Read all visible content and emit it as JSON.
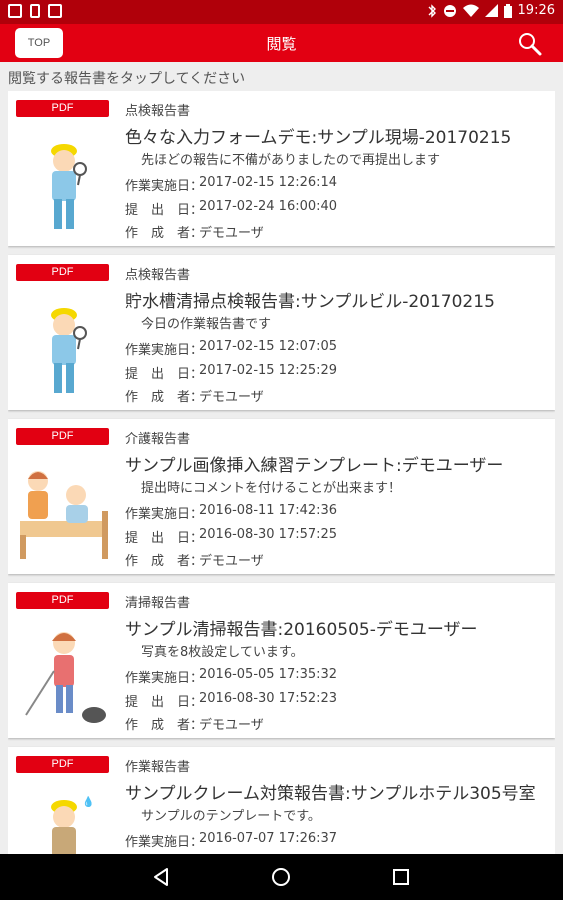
{
  "status_bar": {
    "time": "19:26"
  },
  "app_bar": {
    "top_label": "TOP",
    "title": "閲覧"
  },
  "hint": "閲覧する報告書をタップしてください",
  "labels": {
    "date_label": "作業実施日：",
    "submit_label": "提　出　日：",
    "author_label": "作　成　者："
  },
  "reports": [
    {
      "badge": "PDF",
      "category": "点検報告書",
      "title": "色々な入力フォームデモ:サンプル現場-20170215",
      "comment": "先ほどの報告に不備がありましたので再提出します",
      "work_date": "2017-02-15 12:26:14",
      "submit_date": "2017-02-24 16:00:40",
      "author": "デモユーザ",
      "illustration": "worker-magnifier"
    },
    {
      "badge": "PDF",
      "category": "点検報告書",
      "title": "貯水槽清掃点検報告書:サンプルビル-20170215",
      "comment": "今日の作業報告書です",
      "work_date": "2017-02-15 12:07:05",
      "submit_date": "2017-02-15 12:25:29",
      "author": "デモユーザ",
      "illustration": "worker-magnifier"
    },
    {
      "badge": "PDF",
      "category": "介護報告書",
      "title": "サンプル画像挿入練習テンプレート:デモユーザー",
      "comment": "提出時にコメントを付けることが出来ます！",
      "work_date": "2016-08-11 17:42:36",
      "submit_date": "2016-08-30 17:57:25",
      "author": "デモユーザ",
      "illustration": "caregiver-bed"
    },
    {
      "badge": "PDF",
      "category": "清掃報告書",
      "title": "サンプル清掃報告書:20160505-デモユーザー",
      "comment": "写真を8枚設定しています。",
      "work_date": "2016-05-05 17:35:32",
      "submit_date": "2016-08-30 17:52:23",
      "author": "デモユーザ",
      "illustration": "cleaner-vacuum"
    },
    {
      "badge": "PDF",
      "category": "作業報告書",
      "title": "サンプルクレーム対策報告書:サンプルホテル305号室",
      "comment": "サンプルのテンプレートです。",
      "work_date": "2016-07-07 17:26:37",
      "submit_date": "",
      "author": "",
      "illustration": "worker-sweat"
    }
  ]
}
